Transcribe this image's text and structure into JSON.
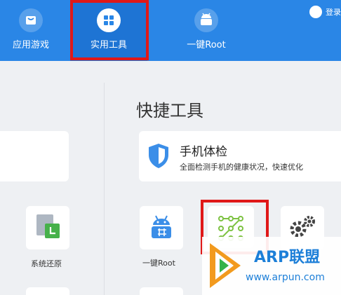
{
  "tabs": [
    {
      "label": "应用游戏",
      "icon": "bag-icon"
    },
    {
      "label": "实用工具",
      "icon": "grid-icon"
    },
    {
      "label": "一键Root",
      "icon": "android-icon"
    }
  ],
  "header": {
    "login_label": "登录"
  },
  "section": {
    "title": "快捷工具"
  },
  "health_check": {
    "title": "手机体检",
    "subtitle": "全面检测手机的健康状况，快速优化"
  },
  "tools": {
    "restore_label": "系统还原",
    "root_label": "一键Root"
  },
  "watermark": {
    "title": "ARP联盟",
    "url": "www.arpun.com"
  },
  "colors": {
    "topbar": "#2a86e6",
    "highlight": "#e01818"
  }
}
